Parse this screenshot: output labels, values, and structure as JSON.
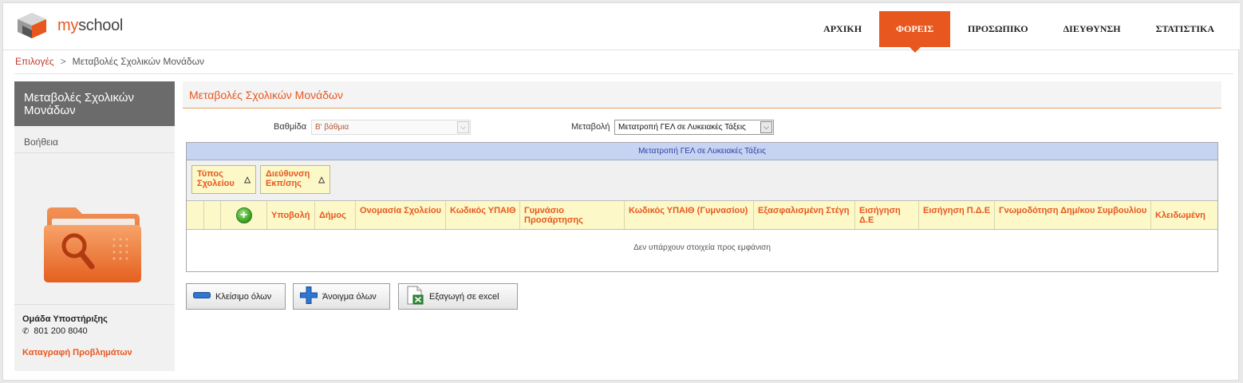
{
  "brand": {
    "my": "my",
    "school": "school"
  },
  "nav": [
    "ΑΡΧΙΚΗ",
    "ΦΟΡΕΙΣ",
    "ΠΡΟΣΩΠΙΚΟ",
    "ΔΙΕΥΘΥΝΣΗ",
    "ΣΤΑΤΙΣΤΙΚΑ"
  ],
  "nav_active": "ΦΟΡΕΙΣ",
  "breadcrumb": {
    "link": "Επιλογές",
    "separator": ">",
    "current": "Μεταβολές Σχολικών Μονάδων"
  },
  "sidebar": {
    "title": "Μεταβολές Σχολικών Μονάδων",
    "help": "Βοήθεια",
    "support_title": "Ομάδα Υποστήριξης",
    "support_phone": "801 200 8040",
    "report_link": "Καταγραφή Προβλημάτων"
  },
  "main": {
    "title": "Μεταβολές Σχολικών Μονάδων",
    "grade_label": "Βαθμίδα",
    "grade_value": "Β' βάθμια",
    "change_label": "Μεταβολή",
    "change_value": "Μετατροπή ΓΕΛ σε Λυκειακές Τάξεις"
  },
  "grid": {
    "caption": "Μετατροπή ΓΕΛ σε Λυκειακές Τάξεις",
    "group_by": [
      "Τύπος Σχολείου",
      "Διεύθυνση Εκπ/σης"
    ],
    "columns": [
      "Υποβολή",
      "Δήμος",
      "Ονομασία Σχολείου",
      "Κωδικός ΥΠΑΙΘ",
      "Γυμνάσιο Προσάρτησης",
      "Κωδικός ΥΠΑΙΘ (Γυμνασίου)",
      "Εξασφαλισμένη Στέγη",
      "Εισήγηση Δ.Ε",
      "Εισήγηση Π.Δ.Ε",
      "Γνωμοδότηση Δημ/κου Συμβουλίου",
      "Κλειδωμένη"
    ],
    "empty_message": "Δεν υπάρχουν στοιχεία προς εμφάνιση"
  },
  "buttons": {
    "collapse_all": "Κλείσιμο όλων",
    "expand_all": "Άνοιγμα όλων",
    "export_excel": "Εξαγωγή σε excel"
  },
  "colors": {
    "accent": "#e8571e",
    "caption_bg": "#c6d3f1",
    "header_bg": "#fcf8c8"
  }
}
